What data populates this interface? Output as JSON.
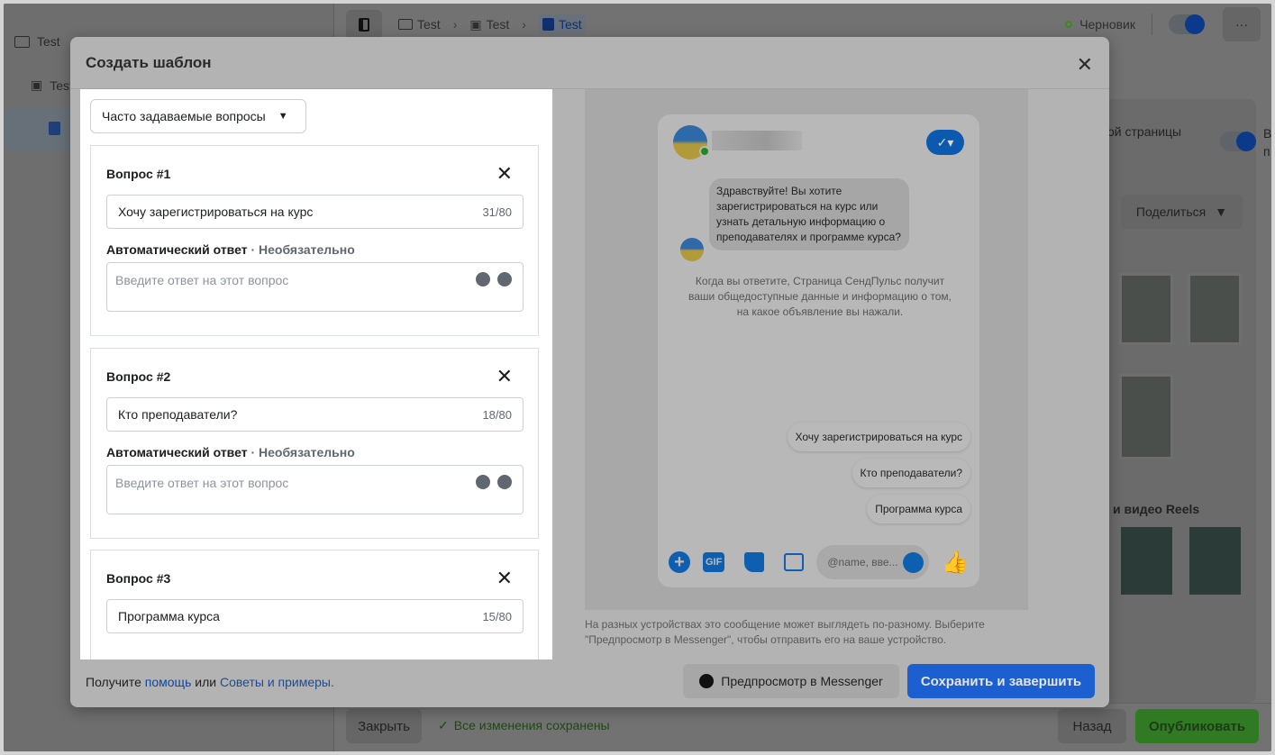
{
  "sidebar": {
    "items": [
      {
        "label": "Test",
        "icon": "folder-icon"
      },
      {
        "label": "Test",
        "icon": "grid-icon"
      },
      {
        "label": "",
        "icon": "document-icon"
      }
    ]
  },
  "topbar": {
    "breadcrumb": [
      "Test",
      "Test",
      "Test"
    ],
    "status": "Черновик"
  },
  "background": {
    "page_label": "ой страницы",
    "share_label": "Поделиться",
    "reels_label": "и видео Reels",
    "side_text": "В п",
    "close_label": "Закрыть",
    "saved_status": "Все изменения сохранены",
    "back_label": "Назад",
    "publish_label": "Опубликовать"
  },
  "modal": {
    "title": "Создать шаблон",
    "template_type": "Часто задаваемые вопросы",
    "questions": [
      {
        "title": "Вопрос #1",
        "value": "Хочу зарегистрироваться на курс",
        "count": "31/80",
        "answer_label": "Автоматический ответ",
        "optional": " · Необязательно",
        "placeholder": "Введите ответ на этот вопрос"
      },
      {
        "title": "Вопрос #2",
        "value": "Кто преподаватели?",
        "count": "18/80",
        "answer_label": "Автоматический ответ",
        "optional": " · Необязательно",
        "placeholder": "Введите ответ на этот вопрос"
      },
      {
        "title": "Вопрос #3",
        "value": "Программа курса",
        "count": "15/80"
      }
    ],
    "preview": {
      "greeting": "Здравствуйте! Вы хотите зарегистрироваться на курс или узнать детальную информацию о преподавателях и программе курса?",
      "notice": "Когда вы ответите, Страница СендПульс получит ваши общедоступные данные и информацию о том, на какое объявление вы нажали.",
      "quick_replies": [
        "Хочу зарегистрироваться на курс",
        "Кто преподаватели?",
        "Программа курса"
      ],
      "composer_placeholder": "@name, вве...",
      "gif_label": "GIF",
      "disclaimer": "На разных устройствах это сообщение может выглядеть по-разному. Выберите \"Предпросмотр в Messenger\", чтобы отправить его на ваше устройство."
    },
    "footer": {
      "prefix": "Получите ",
      "help_link": "помощь",
      "middle": " или ",
      "tips_link": "Советы и примеры.",
      "preview_button": "Предпросмотр в Messenger",
      "save_button": "Сохранить и завершить"
    }
  },
  "colors": {
    "accent": "#1b5fd1",
    "publish": "#2f8a1f",
    "status_dot": "#3a8a1a"
  }
}
